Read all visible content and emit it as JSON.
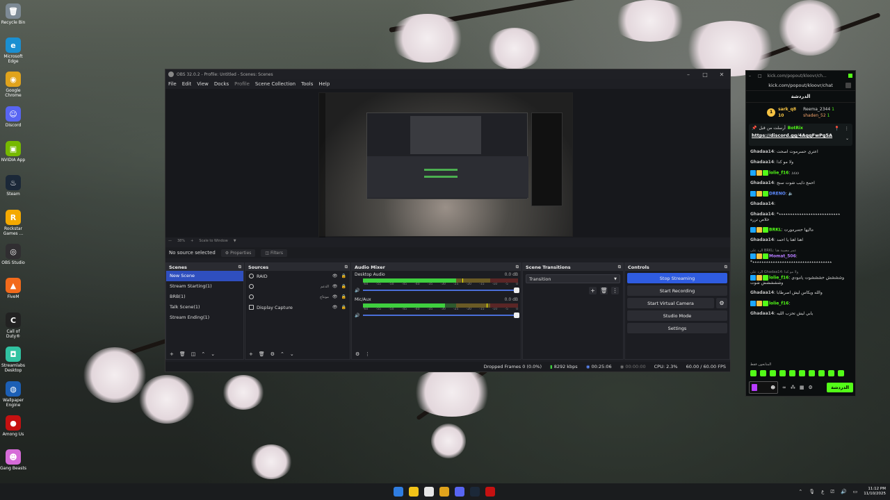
{
  "desktop_icons": [
    {
      "label": "Recycle Bin",
      "color": "#7d8a95",
      "glyph": "🗑"
    },
    {
      "label": "Microsoft Edge",
      "color": "#1b8fd1",
      "glyph": "e"
    },
    {
      "label": "Google Chrome",
      "color": "#e0a31c",
      "glyph": "◉"
    },
    {
      "label": "Discord",
      "color": "#5865f2",
      "glyph": "☺"
    },
    {
      "label": "NVIDIA App",
      "color": "#76b900",
      "glyph": "▣"
    },
    {
      "label": "Steam",
      "color": "#1b2838",
      "glyph": "♨"
    },
    {
      "label": "Rockstar Games ...",
      "color": "#f4a900",
      "glyph": "R"
    },
    {
      "label": "OBS Studio",
      "color": "#302e31",
      "glyph": "◎"
    },
    {
      "label": "FiveM",
      "color": "#f26a1b",
      "glyph": "▲"
    },
    {
      "label": "Call of Duty®",
      "color": "#222222",
      "glyph": "C"
    },
    {
      "label": "Streamlabs Desktop",
      "color": "#31c3a2",
      "glyph": "◘"
    },
    {
      "label": "Wallpaper Engine",
      "color": "#1c5fb5",
      "glyph": "◍"
    },
    {
      "label": "Among Us",
      "color": "#c51111",
      "glyph": "●"
    },
    {
      "label": "Gang Beasts",
      "color": "#d66bd8",
      "glyph": "☻"
    }
  ],
  "obs": {
    "title": "OBS 32.0.2 - Profile: Untitled - Scenes: Scenes",
    "menu": [
      "File",
      "Edit",
      "View",
      "Docks",
      "Profile",
      "Scene Collection",
      "Tools",
      "Help"
    ],
    "zoom": "38%",
    "scale_label": "Scale to Window",
    "no_source": "No source selected",
    "properties": "Properties",
    "filters": "Filters",
    "scenes": {
      "title": "Scenes",
      "items": [
        "New Scene",
        "Stream Starting(1)",
        "BRB(1)",
        "Talk Scene(1)",
        "Stream Ending(1)"
      ]
    },
    "sources": {
      "title": "Sources",
      "items": [
        {
          "name": "RAID",
          "sub": ""
        },
        {
          "name": "",
          "sub": "الدعم"
        },
        {
          "name": "",
          "sub": "مونتاج"
        },
        {
          "name": "Display Capture",
          "sub": ""
        }
      ]
    },
    "mixer": {
      "title": "Audio Mixer",
      "channels": [
        {
          "name": "Desktop Audio",
          "db": "0.0 dB",
          "level": 0.6
        },
        {
          "name": "Mic/Aux",
          "db": "0.0 dB",
          "level": 0.53
        }
      ],
      "ticks": [
        "-60",
        "-55",
        "-50",
        "-45",
        "-40",
        "-35",
        "-30",
        "-25",
        "-20",
        "-15",
        "-10",
        "-5",
        "0"
      ]
    },
    "transitions": {
      "title": "Scene Transitions",
      "selected": "Transition"
    },
    "controls": {
      "title": "Controls",
      "stop_streaming": "Stop Streaming",
      "start_recording": "Start Recording",
      "start_virtual_camera": "Start Virtual Camera",
      "studio_mode": "Studio Mode",
      "settings": "Settings"
    },
    "status": {
      "dropped": "Dropped Frames 0 (0.0%)",
      "kbps": "8292 kbps",
      "stream_time": "00:25:06",
      "rec_time": "00:00:00",
      "cpu": "CPU: 2.3%",
      "fps": "60.00 / 60.00 FPS"
    }
  },
  "chat": {
    "url_title": "kick.com/popout/kloovr/ch...",
    "url": "kick.com/popout/kloovr/chat",
    "header": "الدردشة",
    "leaderboard": [
      {
        "name": "sark_q8",
        "count": "10"
      },
      {
        "name": "Reema_2344",
        "count": "1"
      },
      {
        "name": "shaden_52",
        "count": "1"
      }
    ],
    "top_badge": "1",
    "pinned": {
      "by": "أرسلت من قبل",
      "bot": "BotRix",
      "link": "https://discord.gg/4AqqFwPg5A"
    },
    "messages": [
      {
        "user": "Ghadaa14",
        "color": "#c4c4c4",
        "text": "اعتري حسرموت اصحت",
        "reply": ""
      },
      {
        "user": "Ghadaa14",
        "color": "#c4c4c4",
        "text": "ولا مو كذا",
        "reply": ""
      },
      {
        "user": "lolie_f16",
        "color": "#53fc18",
        "text": "ذذذذ",
        "reply": ""
      },
      {
        "user": "Ghadaa14",
        "color": "#c4c4c4",
        "text": "احمج ذايب شوت سنج",
        "reply": ""
      },
      {
        "user": "DRENO",
        "color": "#5d8bff",
        "text": "🔈",
        "reply": ""
      },
      {
        "user": "Ghadaa14",
        "color": "#c4c4c4",
        "text": "",
        "reply": ""
      },
      {
        "user": "Ghadaa14",
        "color": "#c4c4c4",
        "text": "*٭٭٭٭٭٭٭٭٭٭٭٭٭٭٭٭٭٭٭٭٭٭٭٭٭٭٭ خلاص ترره",
        "reply": ""
      },
      {
        "user": "BRKL",
        "color": "#53fc18",
        "text": "ماليها حسرمورت",
        "reply": ""
      },
      {
        "user": "Ghadaa14",
        "color": "#c4c4c4",
        "text": "اهنا اهنا يا احمد",
        "reply": ""
      },
      {
        "user": "Momat_506",
        "color": "#b57bff",
        "text": "*٭٭٭٭٭٭٭٭٭٭٭٭٭٭٭٭٭٭٭٭٭٭٭٭٭٭٭٭٭٭٭٭٭٭٭",
        "reply": "الرد على BRKL: عمر مصيبة هنا"
      },
      {
        "user": "lolie_f16",
        "color": "#53fc18",
        "text": "وشششش خشششوت يامودي وششششش شوت",
        "reply": "الرد على Ghadaa14: ولا مو كذا"
      },
      {
        "user": "Ghadaa14",
        "color": "#c4c4c4",
        "text": "والله ويكاس ليش اصرطابا",
        "reply": ""
      },
      {
        "user": "lolie_f16",
        "color": "#53fc18",
        "text": "",
        "reply": ""
      },
      {
        "user": "Ghadaa14",
        "color": "#c4c4c4",
        "text": "يابي ليش تحزب الليه",
        "reply": ""
      }
    ],
    "senders_label": "المتابعون فقط",
    "send_label": "الدردشة"
  },
  "taskbar": {
    "time": "11:12 PM",
    "date": "11/10/2025",
    "lang": "ع",
    "apps": [
      "#2f7de1",
      "#f2c318",
      "#e6e6e6",
      "#e0a31c",
      "#5865f2",
      "#1b2838",
      "#c51111"
    ]
  }
}
